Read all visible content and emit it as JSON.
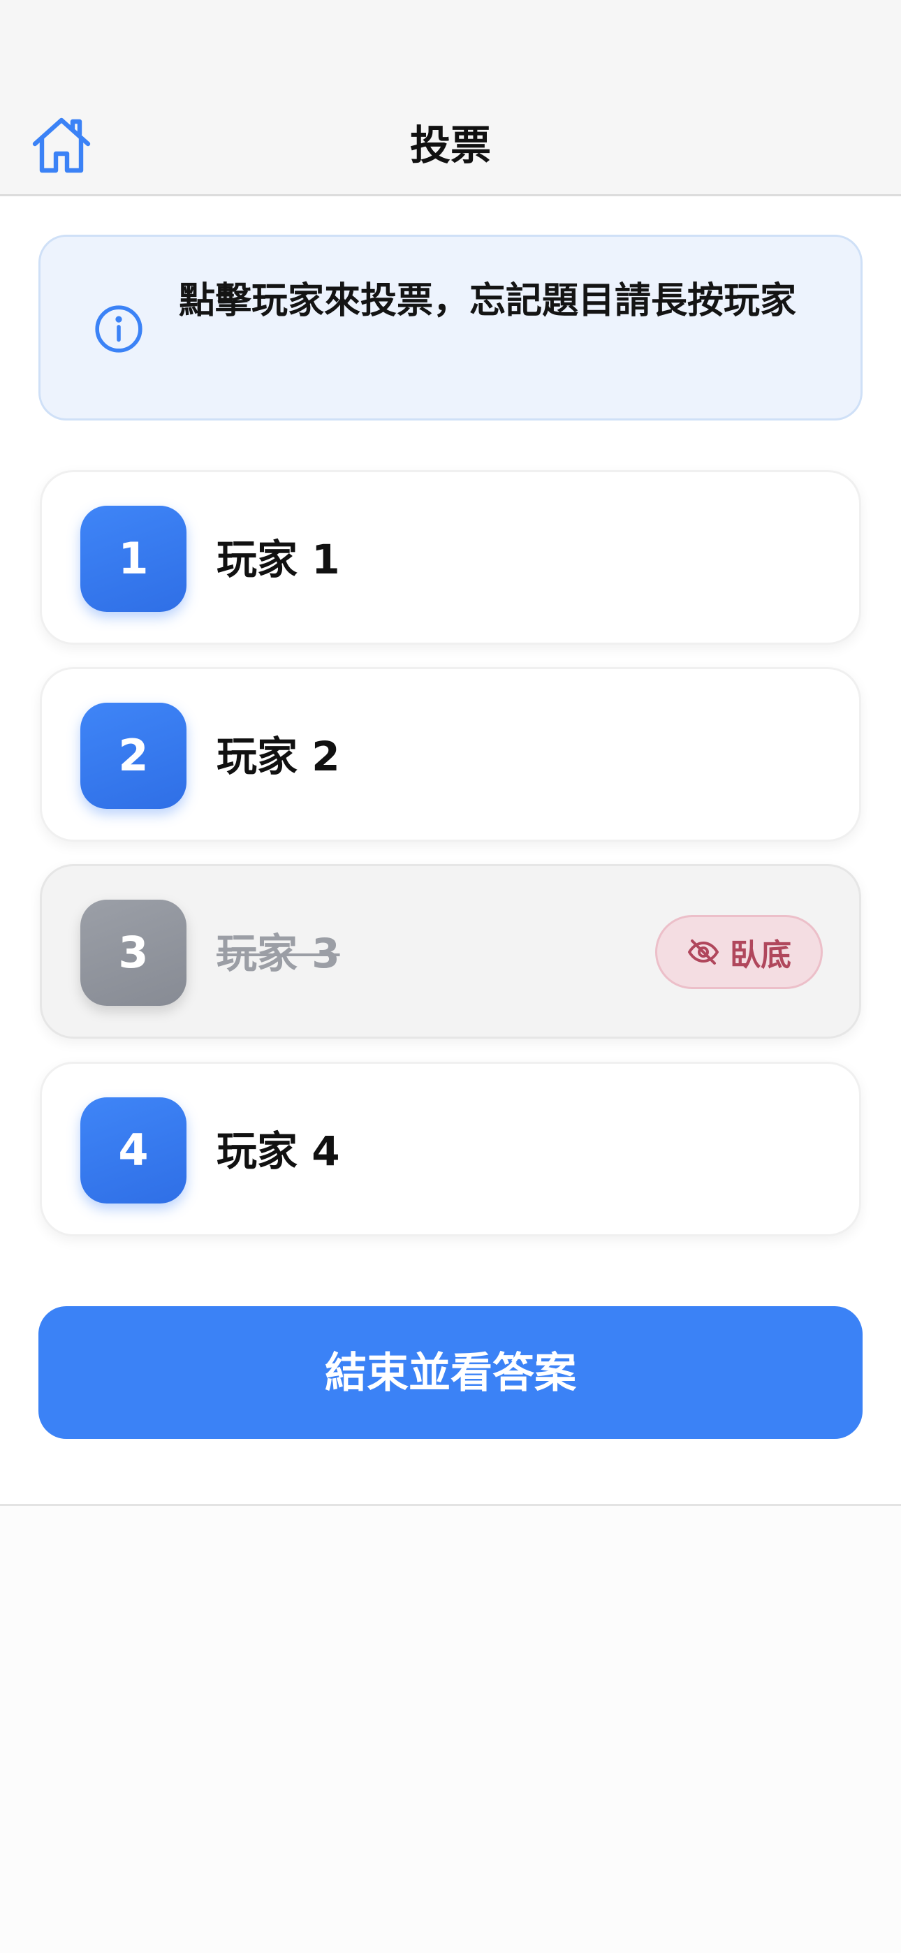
{
  "header": {
    "title": "投票",
    "home_icon": "home-icon"
  },
  "info": {
    "icon": "info-circle-icon",
    "text": "點擊玩家來投票，忘記題目請長按玩家"
  },
  "players": [
    {
      "number": "1",
      "name": "玩家 1",
      "eliminated": false
    },
    {
      "number": "2",
      "name": "玩家 2",
      "eliminated": false
    },
    {
      "number": "3",
      "name": "玩家 3",
      "eliminated": true,
      "tag_label": "臥底",
      "tag_icon": "eye-off-icon"
    },
    {
      "number": "4",
      "name": "玩家 4",
      "eliminated": false
    }
  ],
  "actions": {
    "end_label": "結束並看答案"
  },
  "colors": {
    "accent": "#3b82f6",
    "eliminated_badge": "#8e929a",
    "tag_text": "#b0475c",
    "tag_bg": "#f4dde2",
    "info_bg": "#edf3fd"
  }
}
